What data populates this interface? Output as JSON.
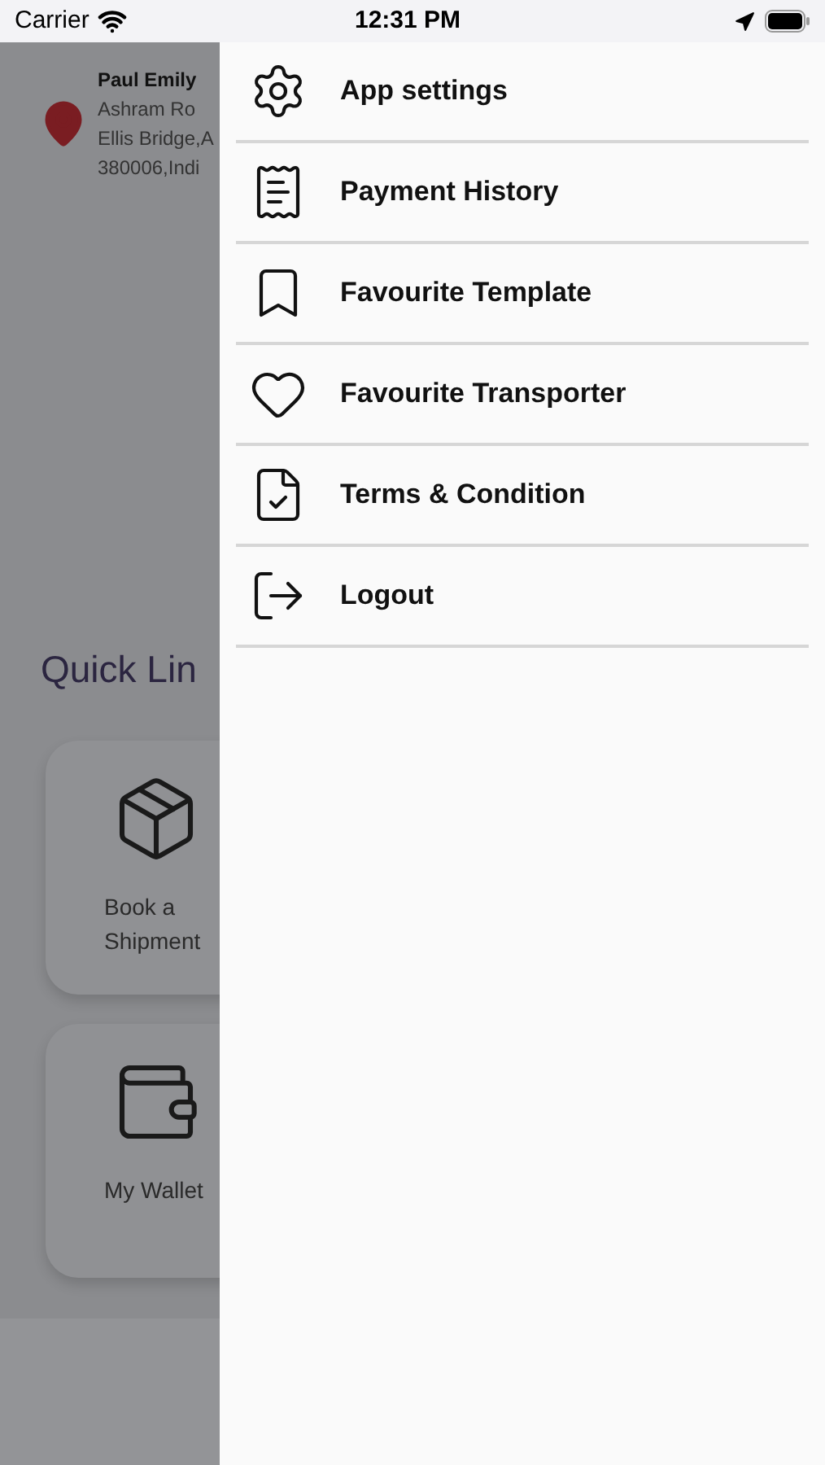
{
  "status_bar": {
    "carrier": "Carrier",
    "time": "12:31 PM"
  },
  "header": {
    "name": "Paul Emily",
    "address_lines": [
      "Ashram Ro",
      "Ellis Bridge,A",
      "380006,Indi"
    ]
  },
  "quick_links": {
    "title": "Quick Lin",
    "cards": [
      {
        "label": "Book a Shipment"
      },
      {
        "label": "My Wallet"
      }
    ]
  },
  "drawer": {
    "items": [
      {
        "label": "App settings"
      },
      {
        "label": "Payment History"
      },
      {
        "label": "Favourite Template"
      },
      {
        "label": "Favourite Transporter"
      },
      {
        "label": "Terms & Condition"
      },
      {
        "label": "Logout"
      }
    ]
  }
}
